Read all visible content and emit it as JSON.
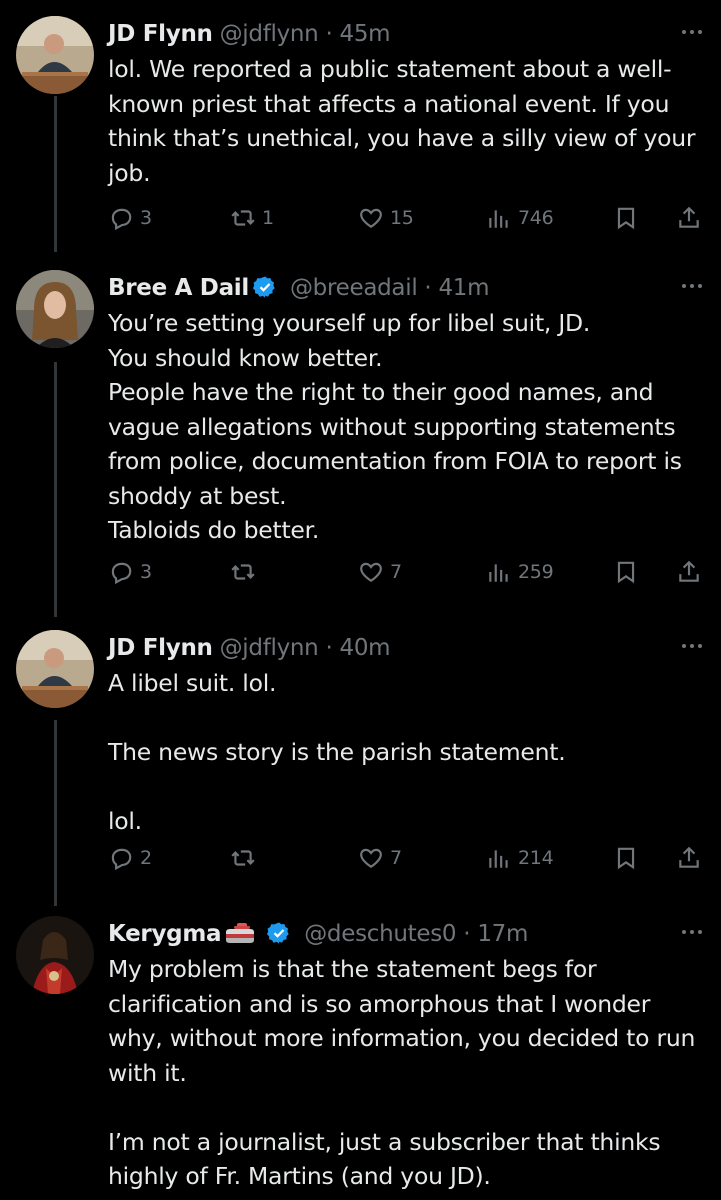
{
  "tweets": [
    {
      "name": "JD Flynn",
      "handle": "@jdflynn",
      "sep": "·",
      "time": "45m",
      "text": "lol. We reported a public statement about a well-known priest that affects a national event. If you think that’s unethical, you have a silly view of your job.",
      "replies": "3",
      "retweets": "1",
      "likes": "15",
      "views": "746"
    },
    {
      "name": "Bree A Dail",
      "handle": "@breeadail",
      "sep": "·",
      "time": "41m",
      "text": "You’re setting yourself up for libel suit, JD.\nYou should know better.\nPeople have the right to their good names, and vague allegations without supporting statements from police, documentation from FOIA to report is shoddy at best.\nTabloids do better.",
      "replies": "3",
      "retweets": "",
      "likes": "7",
      "views": "259"
    },
    {
      "name": "JD Flynn",
      "handle": "@jdflynn",
      "sep": "·",
      "time": "40m",
      "text": "A libel suit. lol.\n\nThe news story is the parish statement.\n\nlol.",
      "replies": "2",
      "retweets": "",
      "likes": "7",
      "views": "214"
    },
    {
      "name": "Kerygma",
      "handle": "@deschutes0",
      "sep": "·",
      "time": "17m",
      "text": "My problem is that the statement begs for clarification and is so amorphous that I wonder why, without more information, you decided to run with it.\n\nI’m not a journalist, just a subscriber that thinks highly of Fr. Martins (and you JD).",
      "replies": "",
      "retweets": "",
      "likes": "",
      "views": ""
    }
  ],
  "colors": {
    "background": "#000000",
    "text": "#e7e9ea",
    "secondary": "#71767b",
    "verified": "#1d9bf0",
    "thread_line": "#333639"
  },
  "icons": [
    "reply-icon",
    "retweet-icon",
    "like-icon",
    "views-icon",
    "bookmark-icon",
    "share-icon",
    "more-icon",
    "verified-badge-icon",
    "curling-stone-icon"
  ]
}
